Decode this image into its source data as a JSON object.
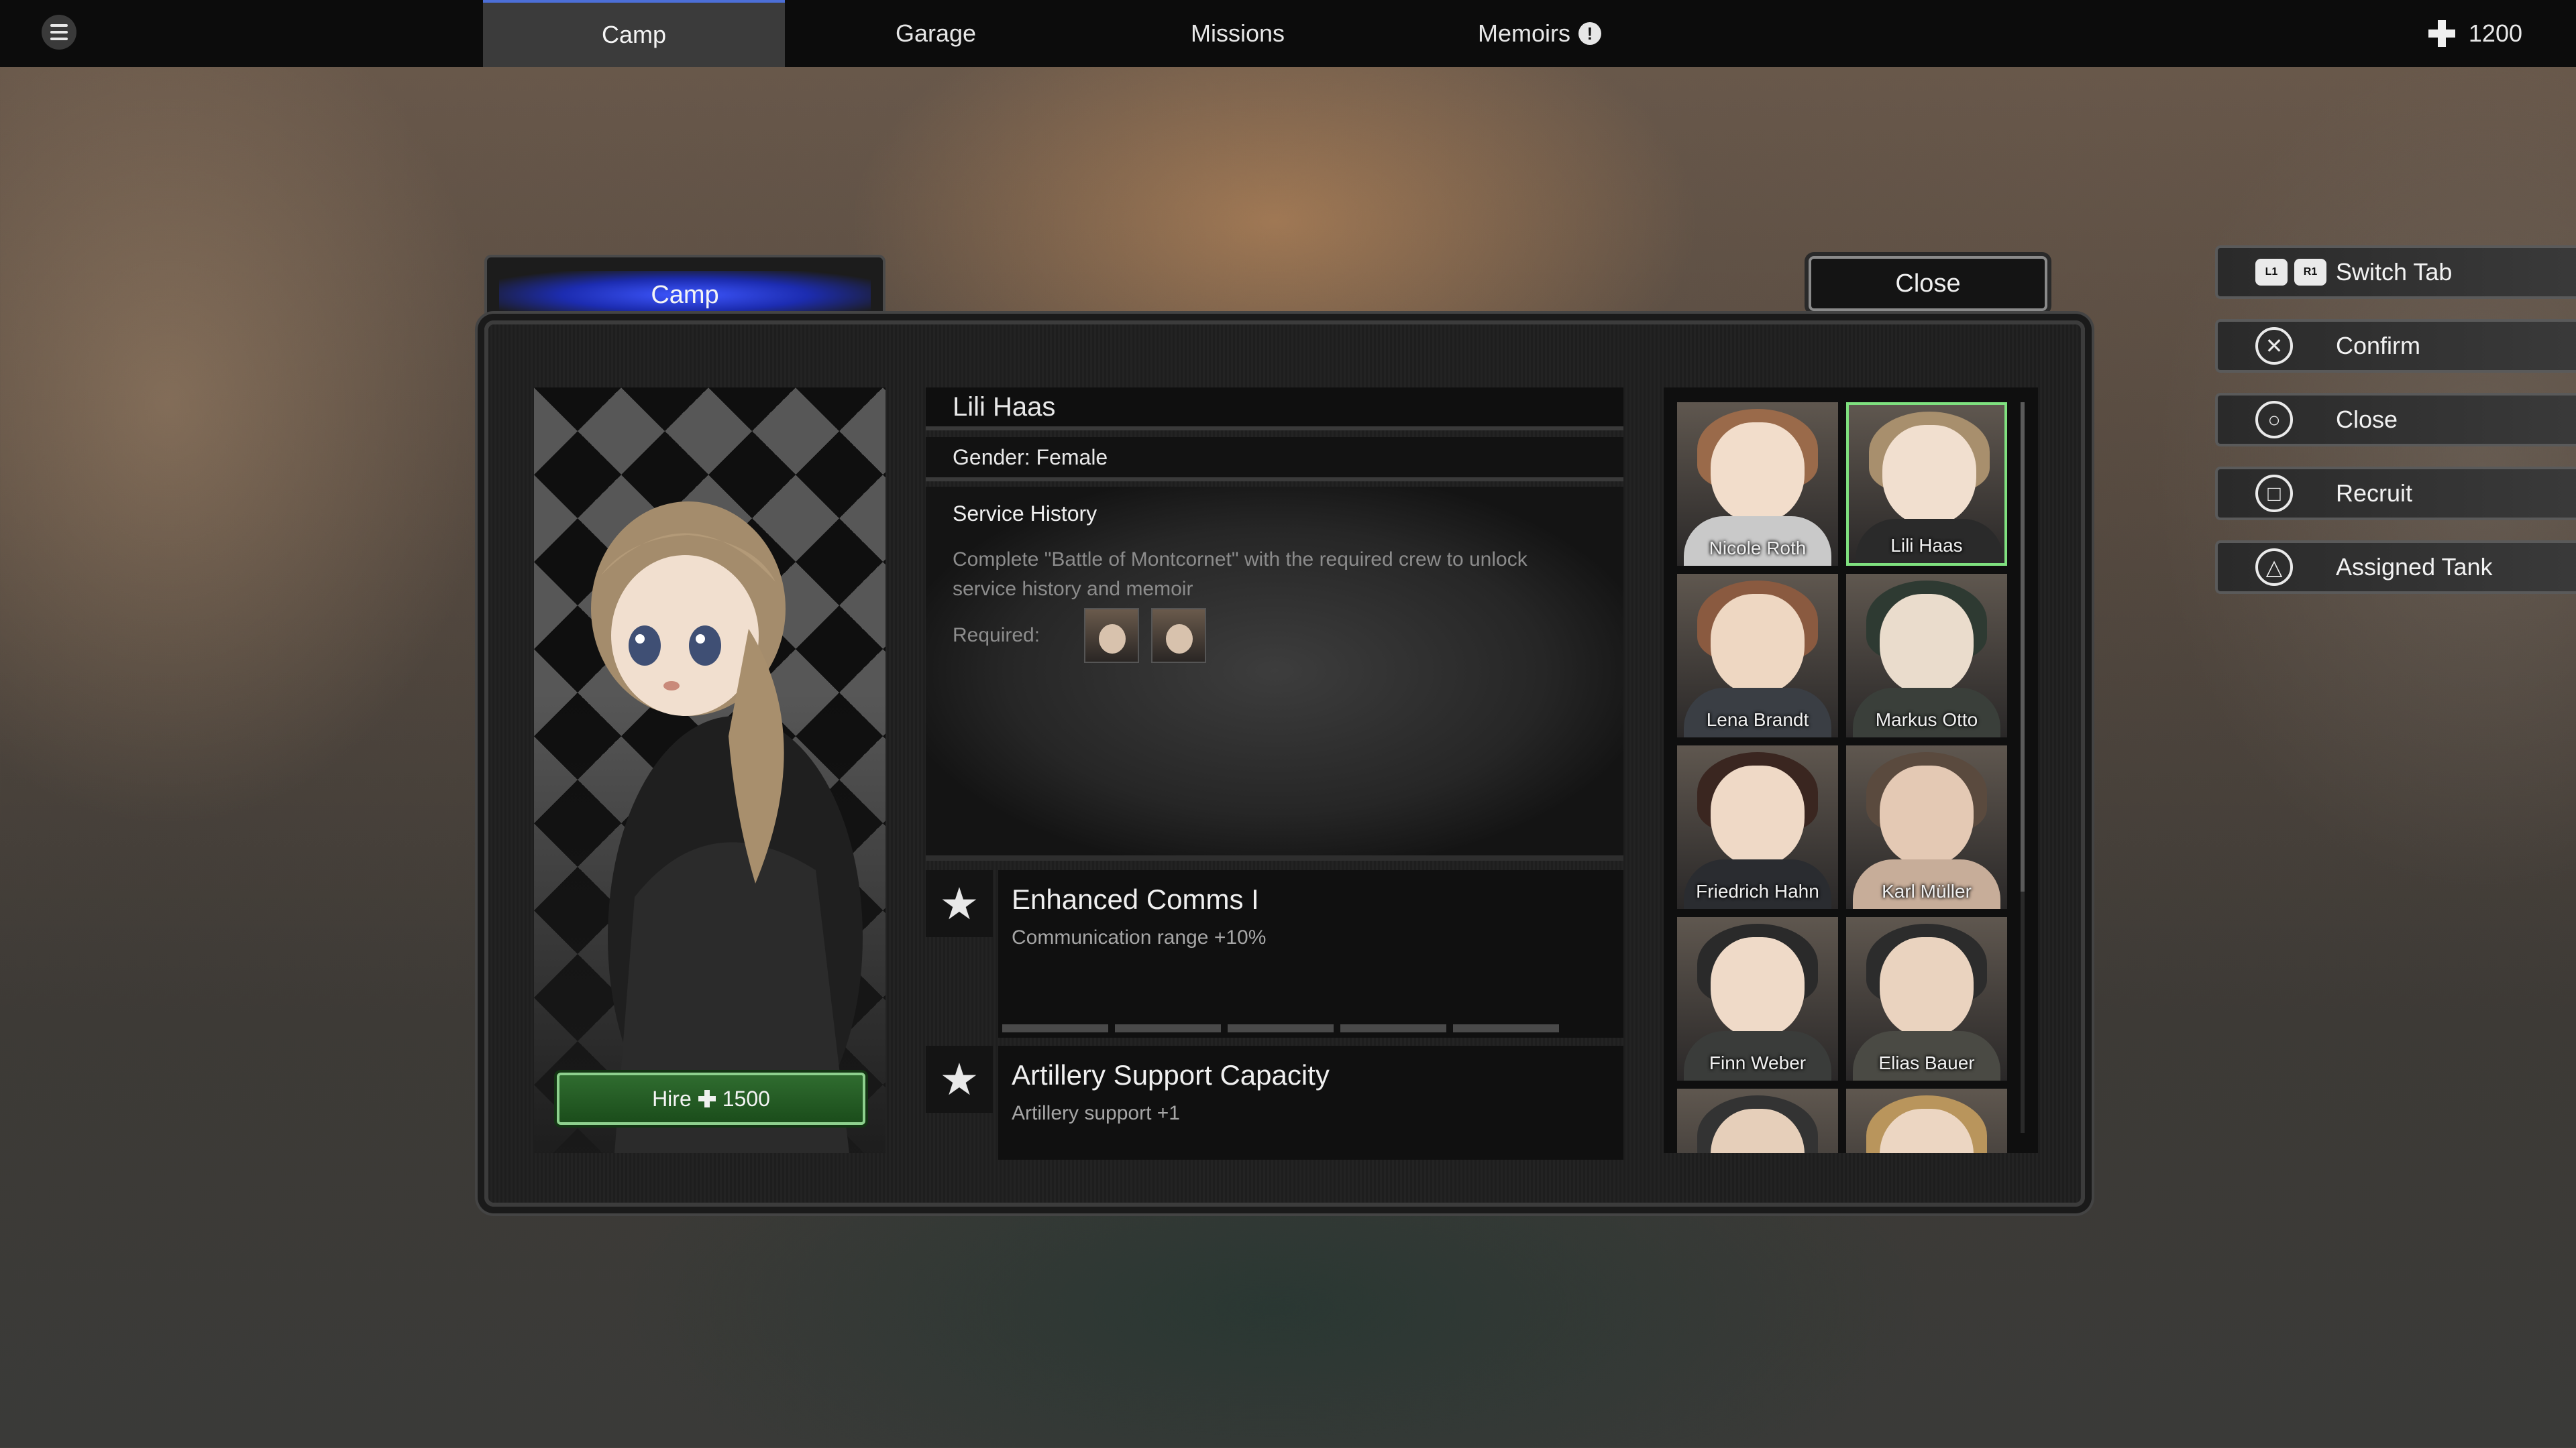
{
  "topbar": {
    "tabs": [
      "Camp",
      "Garage",
      "Missions",
      "Memoirs"
    ],
    "memoirs_alert": "!",
    "currency_amount": "1200",
    "currency_icon": "iron-cross-icon"
  },
  "panel": {
    "tab_label": "Camp",
    "close_label": "Close"
  },
  "character": {
    "name": "Lili Haas",
    "gender": "Gender: Female",
    "hire_label": "Hire",
    "hire_cost": "1500",
    "service_history": {
      "title": "Service History",
      "text": "Complete \"Battle of Montcornet\" with the required crew to unlock service history and memoir",
      "required_label": "Required:"
    },
    "skills": [
      {
        "name": "Enhanced Comms I",
        "desc": "Communication range +10%",
        "level": 0,
        "max_level": 5
      },
      {
        "name": "Artillery Support Capacity",
        "desc": "Artillery support +1"
      }
    ]
  },
  "roster": [
    {
      "name": "Nicole Roth"
    },
    {
      "name": "Lili Haas",
      "selected": true
    },
    {
      "name": "Lena Brandt"
    },
    {
      "name": "Markus Otto"
    },
    {
      "name": "Friedrich Hahn"
    },
    {
      "name": "Karl Müller"
    },
    {
      "name": "Finn Weber"
    },
    {
      "name": "Elias Bauer"
    }
  ],
  "controls": [
    {
      "label": "Switch Tab",
      "keys": [
        "L1",
        "R1"
      ]
    },
    {
      "label": "Confirm",
      "icon": "cross-button-icon",
      "glyph": "✕"
    },
    {
      "label": "Close",
      "icon": "circle-button-icon",
      "glyph": "○"
    },
    {
      "label": "Recruit",
      "icon": "square-button-icon",
      "glyph": "□"
    },
    {
      "label": "Assigned Tank",
      "icon": "triangle-button-icon",
      "glyph": "△"
    }
  ],
  "colors": {
    "tab_accent": "#4c6fd8",
    "selected_border": "#7fe07f",
    "hire_green": "#2f6c2f"
  }
}
